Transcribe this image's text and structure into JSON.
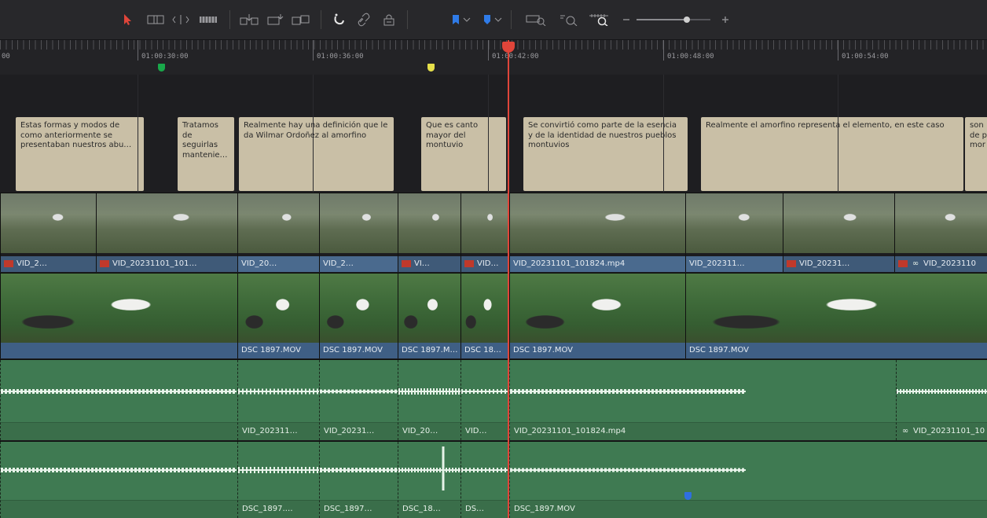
{
  "toolbar": {
    "icons": [
      "selection-arrow",
      "trim-edit",
      "dynamic-trim",
      "blade",
      "insert-clip",
      "overwrite-clip",
      "replace-clip",
      "snapping",
      "linked-selection",
      "position-lock",
      "flag",
      "marker",
      "zoom-full",
      "zoom-detail",
      "zoom-custom",
      "zoom-out",
      "zoom-slider",
      "zoom-in"
    ],
    "accent": "#e0453a"
  },
  "ruler": {
    "timecodes": [
      "00",
      "01:00:30:00",
      "01:00:36:00",
      "01:00:42:00",
      "01:00:48:00",
      "01:00:54:00"
    ]
  },
  "markers": [
    {
      "color": "#19a84a"
    },
    {
      "color": "#e6e04a"
    },
    {
      "color": "#2f6fe0"
    }
  ],
  "subtitles": [
    "Estas formas y modos de como anteriormente se presentaban nuestros abu…",
    "Tratamos de seguirlas mantenie…",
    "Realmente hay una definición que le da Wilmar Ordoñez al amorfino",
    "Que es canto mayor del montuvio",
    "Se convirtió como parte de la esencia y de la identidad de nuestros pueblos montuvios",
    "Realmente el amorfino representa el elemento, en este caso",
    "son de p mor"
  ],
  "video2_clips": [
    "VID_2…",
    "VID_20231101_101…",
    "VID_20…",
    "VID_2…",
    "VI…",
    "VID…",
    "VID_20231101_101824.mp4",
    "VID_202311…",
    "VID_20231…",
    "VID_2023110"
  ],
  "video1_clips": [
    "",
    "DSC 1897.MOV",
    "DSC 1897.MOV",
    "DSC 1897.M…",
    "DSC 18…",
    "DSC 1897.MOV",
    "DSC 1897.MOV"
  ],
  "audio1_clips": [
    "",
    "VID_202311…",
    "VID_20231…",
    "VID_20…",
    "VID…",
    "VID_20231101_101824.mp4",
    "VID_20231101_10"
  ],
  "audio2_clips": [
    "",
    "DSC_1897.…",
    "DSC_1897…",
    "DSC_18…",
    "DS…",
    "DSC_1897.MOV"
  ]
}
